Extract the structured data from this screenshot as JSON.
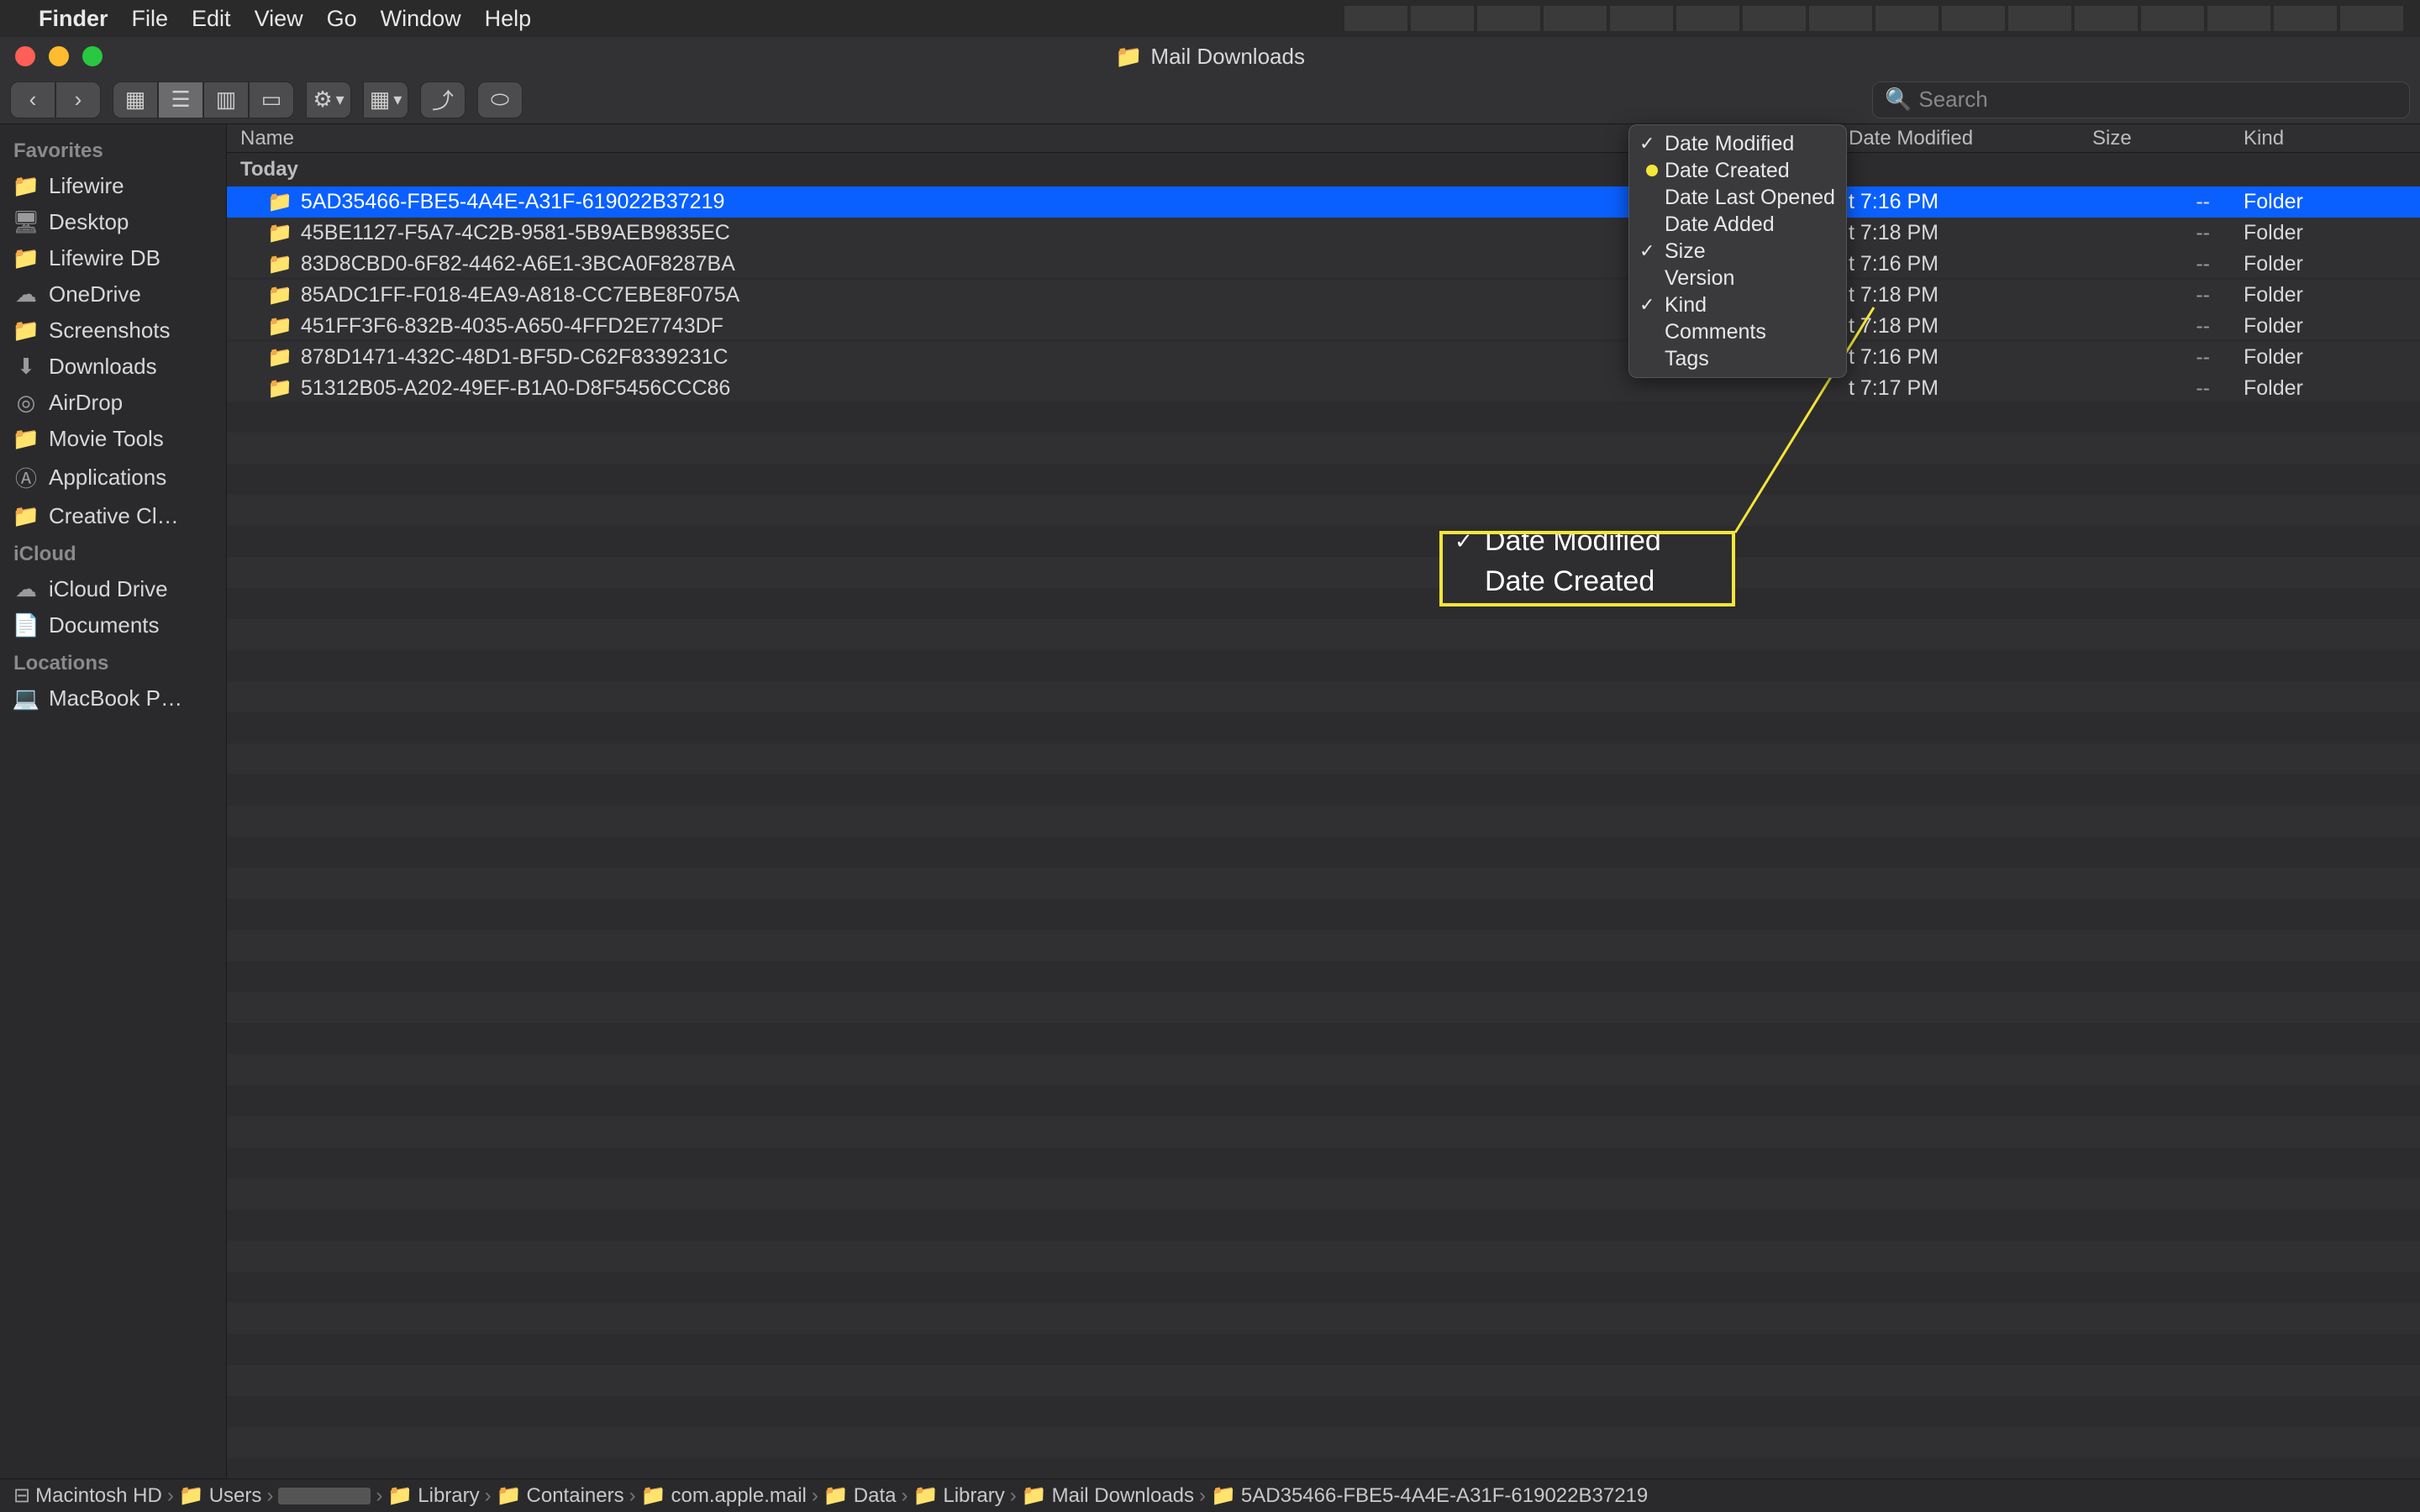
{
  "menubar": {
    "app": "Finder",
    "items": [
      "File",
      "Edit",
      "View",
      "Go",
      "Window",
      "Help"
    ]
  },
  "window": {
    "title": "Mail Downloads",
    "search_placeholder": "Search"
  },
  "sidebar": {
    "sections": [
      {
        "title": "Favorites",
        "items": [
          {
            "icon": "folder",
            "label": "Lifewire"
          },
          {
            "icon": "desktop",
            "label": "Desktop"
          },
          {
            "icon": "folder",
            "label": "Lifewire DB"
          },
          {
            "icon": "cloud",
            "label": "OneDrive"
          },
          {
            "icon": "folder",
            "label": "Screenshots"
          },
          {
            "icon": "download",
            "label": "Downloads"
          },
          {
            "icon": "airdrop",
            "label": "AirDrop"
          },
          {
            "icon": "folder",
            "label": "Movie Tools"
          },
          {
            "icon": "apps",
            "label": "Applications"
          },
          {
            "icon": "folder",
            "label": "Creative Cl…"
          }
        ]
      },
      {
        "title": "iCloud",
        "items": [
          {
            "icon": "cloud",
            "label": "iCloud Drive"
          },
          {
            "icon": "doc",
            "label": "Documents"
          }
        ]
      },
      {
        "title": "Locations",
        "items": [
          {
            "icon": "laptop",
            "label": "MacBook P…"
          }
        ]
      }
    ]
  },
  "columns": {
    "name": "Name",
    "date": "Date Modified",
    "size": "Size",
    "kind": "Kind"
  },
  "group_label": "Today",
  "rows": [
    {
      "name": "5AD35466-FBE5-4A4E-A31F-619022B37219",
      "date": "t 7:16 PM",
      "size": "--",
      "kind": "Folder",
      "selected": true
    },
    {
      "name": "45BE1127-F5A7-4C2B-9581-5B9AEB9835EC",
      "date": "t 7:18 PM",
      "size": "--",
      "kind": "Folder"
    },
    {
      "name": "83D8CBD0-6F82-4462-A6E1-3BCA0F8287BA",
      "date": "t 7:16 PM",
      "size": "--",
      "kind": "Folder"
    },
    {
      "name": "85ADC1FF-F018-4EA9-A818-CC7EBE8F075A",
      "date": "t 7:18 PM",
      "size": "--",
      "kind": "Folder"
    },
    {
      "name": "451FF3F6-832B-4035-A650-4FFD2E7743DF",
      "date": "t 7:18 PM",
      "size": "--",
      "kind": "Folder"
    },
    {
      "name": "878D1471-432C-48D1-BF5D-C62F8339231C",
      "date": "t 7:16 PM",
      "size": "--",
      "kind": "Folder"
    },
    {
      "name": "51312B05-A202-49EF-B1A0-D8F5456CCC86",
      "date": "t 7:17 PM",
      "size": "--",
      "kind": "Folder"
    }
  ],
  "context_menu": [
    {
      "label": "Date Modified",
      "checked": true
    },
    {
      "label": "Date Created",
      "checked": false,
      "highlighted": true
    },
    {
      "label": "Date Last Opened",
      "checked": false
    },
    {
      "label": "Date Added",
      "checked": false
    },
    {
      "label": "Size",
      "checked": true
    },
    {
      "label": "Version",
      "checked": false
    },
    {
      "label": "Kind",
      "checked": true
    },
    {
      "label": "Comments",
      "checked": false
    },
    {
      "label": "Tags",
      "checked": false
    }
  ],
  "callout": {
    "top": "Date Modified",
    "main": "Date Created"
  },
  "path": [
    {
      "icon": "hd",
      "label": "Macintosh HD"
    },
    {
      "icon": "fd",
      "label": "Users"
    },
    {
      "icon": "redact",
      "label": ""
    },
    {
      "icon": "fd",
      "label": "Library"
    },
    {
      "icon": "fd",
      "label": "Containers"
    },
    {
      "icon": "fd",
      "label": "com.apple.mail"
    },
    {
      "icon": "fd",
      "label": "Data"
    },
    {
      "icon": "fd",
      "label": "Library"
    },
    {
      "icon": "fd",
      "label": "Mail Downloads"
    },
    {
      "icon": "fd",
      "label": "5AD35466-FBE5-4A4E-A31F-619022B37219"
    }
  ]
}
